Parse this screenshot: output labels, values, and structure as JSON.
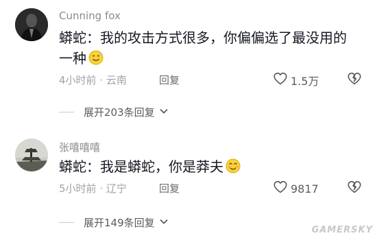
{
  "comments": [
    {
      "username": "Cunning fox",
      "text": "蟒蛇：我的攻击方式很多，你偏偏选了最没用的一种",
      "emoji": "smile-emoji",
      "time": "4小时前",
      "location": "云南",
      "reply_label": "回复",
      "likes": "1.5万",
      "expand_label": "展开203条回复"
    },
    {
      "username": "张嘻嘻嘻",
      "text": "蟒蛇：我是蟒蛇，你是莽夫",
      "emoji": "blush-emoji",
      "time": "5小时前",
      "location": "辽宁",
      "reply_label": "回复",
      "likes": "9817",
      "expand_label": "展开149条回复"
    }
  ],
  "separator": " · ",
  "watermark": "GAMERSKY",
  "colors": {
    "text": "#161823",
    "muted": "#8a8b91",
    "meta": "#a1a2a7"
  }
}
